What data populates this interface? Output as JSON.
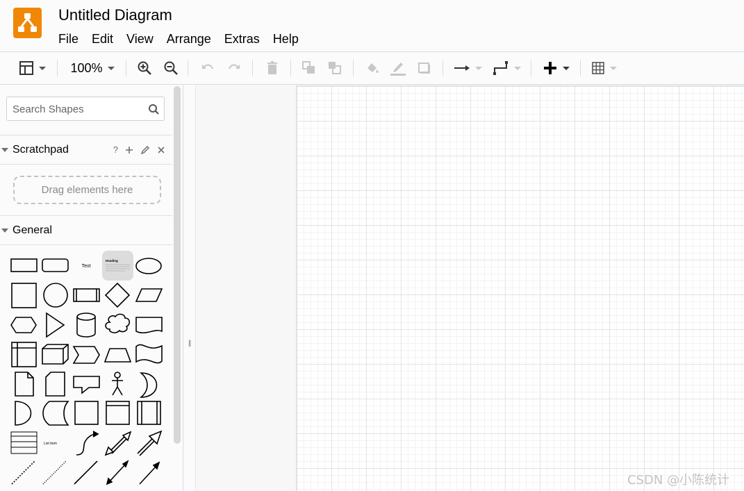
{
  "app": {
    "title": "Untitled Diagram",
    "accent": "#f08705"
  },
  "menu": [
    "File",
    "Edit",
    "View",
    "Arrange",
    "Extras",
    "Help"
  ],
  "toolbar": {
    "zoom": "100%",
    "icons": [
      "format-panel-icon",
      "zoom-in-icon",
      "zoom-out-icon",
      "undo-icon",
      "redo-icon",
      "delete-icon",
      "to-front-icon",
      "to-back-icon",
      "fill-color-icon",
      "line-color-icon",
      "shadow-icon",
      "connection-icon",
      "waypoints-icon",
      "insert-plus-icon",
      "table-icon"
    ]
  },
  "sidebar": {
    "search_placeholder": "Search Shapes",
    "scratchpad": {
      "title": "Scratchpad",
      "help": "?",
      "dropzone": "Drag elements here"
    },
    "general": {
      "title": "General",
      "text_shape_label": "Text",
      "heading_shape_label": "Heading",
      "list_items_label": "List Item"
    }
  },
  "watermark": "CSDN @小陈统计"
}
